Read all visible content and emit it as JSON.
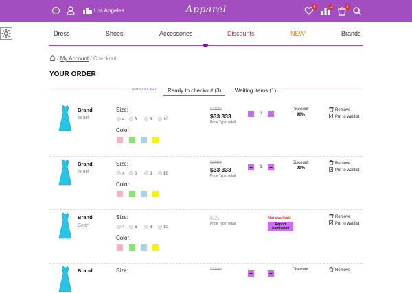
{
  "topbar": {
    "info_icon": "info-icon",
    "user_icon": "user-icon",
    "city_icon": "city-icon",
    "city": "Los Angeles",
    "logo": "Apparel",
    "wishlist_badge": "4",
    "compare_badge": "12",
    "cart_badge": "5",
    "bg_color": "#a24ec0"
  },
  "nav": {
    "items": [
      "Dress",
      "Shoes",
      "Accessories",
      "Discounts",
      "NEW",
      "Brands"
    ],
    "discount_color": "#b03a3a",
    "new_color": "#d6891f"
  },
  "breadcrumb": {
    "sep": "/",
    "my_account": "My Account",
    "current": "Checkout"
  },
  "page_title": "YOUR ORDER",
  "tabs": {
    "items_in_cart": "ITEMS IN CART",
    "ready": "Ready to checkout (3)",
    "waiting": "Waiting Items (1)"
  },
  "labels": {
    "size": "Size:",
    "color": "Color:",
    "discount": "Discount:",
    "remove": "Remove",
    "waitlist": "Put to waitlist",
    "price_type": "Price Type: retail",
    "not_available": "Not available",
    "report_admission": "Report Admission"
  },
  "sizes": [
    "4",
    "6",
    "8",
    "10"
  ],
  "swatches": [
    "#f7b3c0",
    "#8fe07e",
    "#a9d4e8",
    "#f3f21a"
  ],
  "items": [
    {
      "brand": "Brand",
      "sub": "scarf",
      "old_price": "$3030",
      "price": "$33 333",
      "qty": "1",
      "discount": "90%"
    },
    {
      "brand": "Brand",
      "sub": "scarf",
      "old_price": "$3030",
      "price": "$33 333",
      "qty": "1",
      "discount": "90%"
    },
    {
      "brand": "Brand",
      "sub": "Scarf",
      "price": "$55",
      "available": false
    },
    {
      "brand": "Brand",
      "old_price": "$3030",
      "discount": "Discount:"
    }
  ]
}
